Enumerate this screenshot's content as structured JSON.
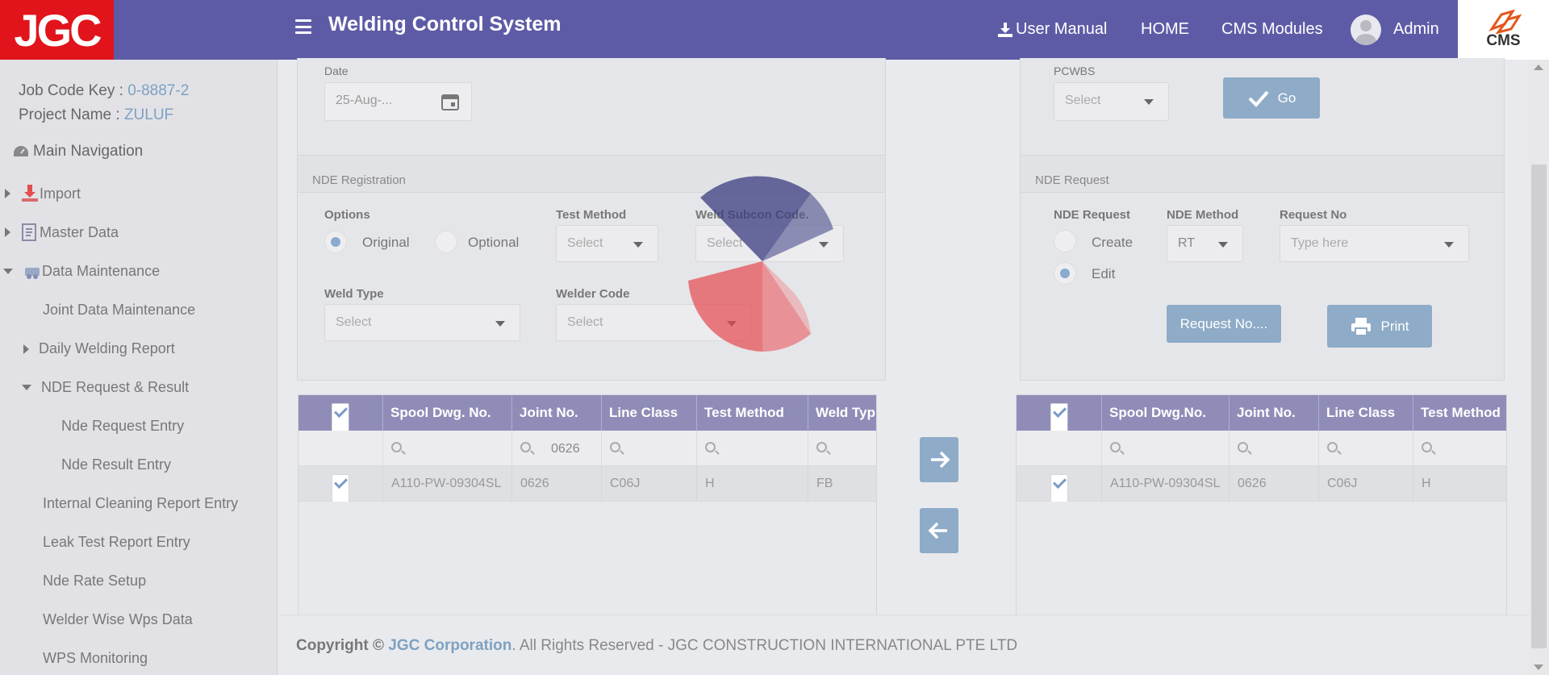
{
  "header": {
    "logo_text": "JGC",
    "app_title": "Welding Control System",
    "user_manual": "User Manual",
    "home": "HOME",
    "cms_modules": "CMS Modules",
    "user_name": "Admin",
    "cms_logo_text": "CMS",
    "brand_color": "#5e5ba6",
    "logo_color": "#e1141c"
  },
  "sidebar": {
    "job_code_label": "Job Code Key :",
    "job_code_value": "0-8887-2",
    "project_label": "Project Name :",
    "project_value": "ZULUF",
    "main_nav": "Main Navigation",
    "items": {
      "import": "Import",
      "master_data": "Master Data",
      "data_maintenance": "Data Maintenance",
      "joint_data": "Joint Data Maintenance",
      "daily_welding": "Daily Welding Report",
      "nde_req_result": "NDE Request & Result",
      "nde_request_entry": "Nde Request Entry",
      "nde_result_entry": "Nde Result Entry",
      "internal_cleaning": "Internal Cleaning Report Entry",
      "leak_test": "Leak Test Report Entry",
      "nde_rate": "Nde Rate Setup",
      "welder_wise": "Welder Wise Wps Data",
      "wps_monitoring": "WPS Monitoring"
    }
  },
  "top_filters": {
    "date_label": "Date",
    "date_value": "25-Aug-...",
    "pcwbs_label": "PCWBS",
    "pcwbs_value": "Select",
    "go_button": "Go"
  },
  "nde_registration": {
    "title": "NDE Registration",
    "options_label": "Options",
    "option_original": "Original",
    "option_optional": "Optional",
    "test_method_label": "Test Method",
    "test_method_value": "Select",
    "weld_subcon_label": "Weld Subcon Code.",
    "weld_subcon_value": "Select",
    "weld_type_label": "Weld Type",
    "weld_type_value": "Select",
    "welder_code_label": "Welder Code",
    "welder_code_value": "Select"
  },
  "nde_request": {
    "title": "NDE Request",
    "request_label": "NDE Request",
    "create": "Create",
    "edit": "Edit",
    "method_label": "NDE Method",
    "method_value": "RT",
    "request_no_label": "Request No",
    "request_no_placeholder": "Type here",
    "request_no_button": "Request No....",
    "print_button": "Print"
  },
  "left_grid": {
    "columns": [
      "Spool Dwg. No.",
      "Joint No.",
      "Line Class",
      "Test Method",
      "Weld Typ"
    ],
    "filter_joint": "0626",
    "rows": [
      [
        "A110-PW-09304SL",
        "0626",
        "C06J",
        "H",
        "FB"
      ]
    ]
  },
  "right_grid": {
    "columns": [
      "Spool Dwg.No.",
      "Joint No.",
      "Line Class",
      "Test Method"
    ],
    "rows": [
      [
        "A110-PW-09304SL",
        "0626",
        "C06J",
        "H"
      ]
    ]
  },
  "footer": {
    "copyright": "Copyright ©",
    "corp": "JGC Corporation",
    "rest": ". All Rights Reserved - JGC CONSTRUCTION INTERNATIONAL PTE LTD"
  }
}
